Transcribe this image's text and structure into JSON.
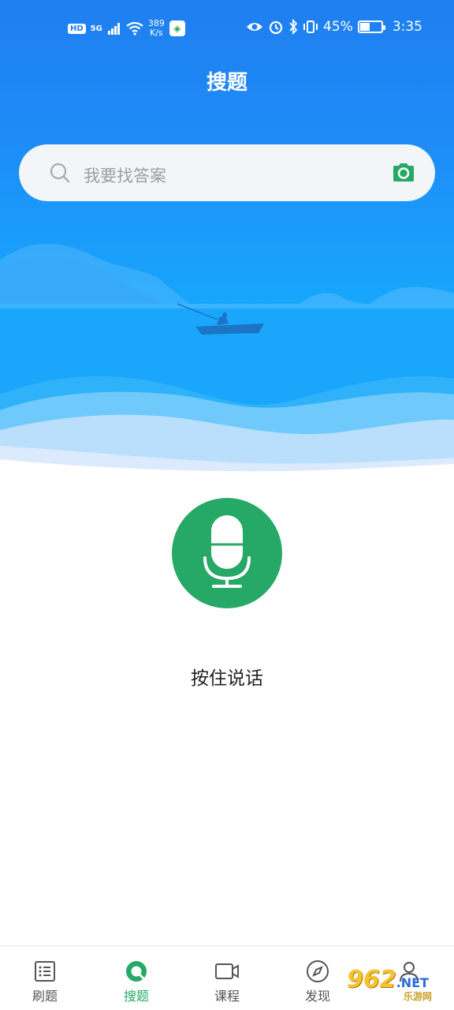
{
  "status_bar": {
    "hd": "HD",
    "network": "5G",
    "speed_value": "389",
    "speed_unit": "K/s",
    "battery": "45%",
    "battery_level": 0.45,
    "time": "3:35"
  },
  "header": {
    "title": "搜题"
  },
  "search": {
    "placeholder": "我要找答案"
  },
  "voice": {
    "hint": "按住说话"
  },
  "tabs": [
    {
      "label": "刷题",
      "icon": "list-icon",
      "active": false
    },
    {
      "label": "搜题",
      "icon": "search-circle-icon",
      "active": true
    },
    {
      "label": "课程",
      "icon": "video-icon",
      "active": false
    },
    {
      "label": "发现",
      "icon": "compass-icon",
      "active": false
    },
    {
      "label": "",
      "icon": "profile-icon",
      "active": false
    }
  ],
  "watermark": {
    "brand": "962",
    "net": ".NET",
    "sub": "乐游网"
  },
  "colors": {
    "accent": "#26a866",
    "hero_top": "#1f7ff0",
    "hero_bottom": "#3fbdfc"
  }
}
